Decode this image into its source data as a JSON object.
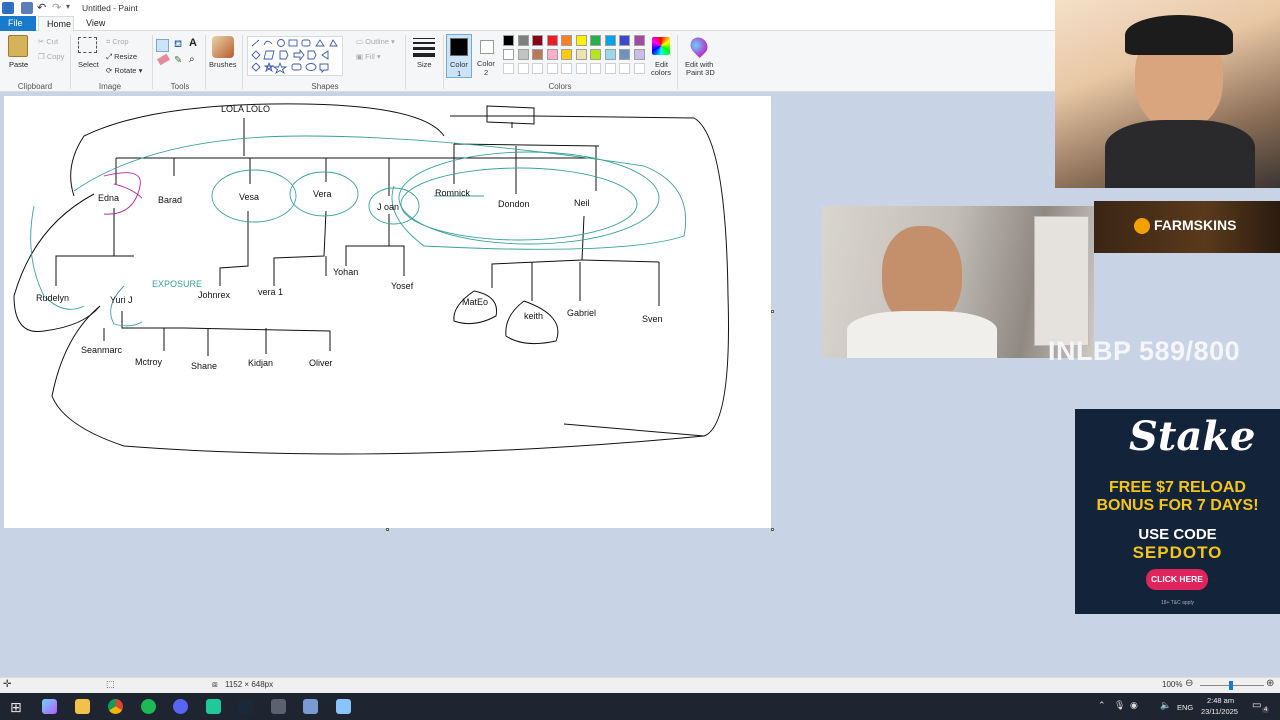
{
  "window": {
    "title": "Untitled - Paint"
  },
  "menu": {
    "file": "File",
    "home": "Home",
    "view": "View"
  },
  "ribbon": {
    "clipboard": {
      "paste": "Paste",
      "cut": "Cut",
      "copy": "Copy",
      "label": "Clipboard"
    },
    "image": {
      "select": "Select",
      "crop": "Crop",
      "resize": "Resize",
      "rotate": "Rotate",
      "label": "Image"
    },
    "tools": {
      "label": "Tools"
    },
    "brushes": {
      "label": "Brushes"
    },
    "shapes": {
      "outline": "Outline",
      "fill": "Fill",
      "label": "Shapes"
    },
    "size": {
      "label": "Size"
    },
    "color1": {
      "label": "Color",
      "num": "1"
    },
    "color2": {
      "label": "Color",
      "num": "2"
    },
    "colors": {
      "label": "Colors"
    },
    "edit_colors": {
      "line1": "Edit",
      "line2": "colors"
    },
    "edit_paint3d": {
      "line1": "Edit with",
      "line2": "Paint 3D"
    },
    "palette_row1": [
      "#000000",
      "#7f7f7f",
      "#880015",
      "#ed1c24",
      "#ff7f27",
      "#fff200",
      "#22b14c",
      "#00a2e8",
      "#3f48cc",
      "#a349a4"
    ],
    "palette_row2": [
      "#ffffff",
      "#c3c3c3",
      "#b97a57",
      "#ffaec9",
      "#ffc90e",
      "#efe4b0",
      "#b5e61d",
      "#99d9ea",
      "#7092be",
      "#c8bfe7"
    ]
  },
  "canvas": {
    "labels": {
      "root": "LOLA LOLO",
      "edna": "Edna",
      "barad": "Barad",
      "vesa": "Vesa",
      "vera": "Vera",
      "joan": "J oan",
      "romnick": "Romnick",
      "dondon": "Dondon",
      "neil": "Neil",
      "exposure": "EXPOSURE",
      "rudelyn": "Rudelyn",
      "yuri": "Yuri J",
      "johnrex": "Johnrex",
      "vera1": "vera 1",
      "yohan": "Yohan",
      "yosef": "Yosef",
      "mateo": "MatEo",
      "keith": "keith",
      "gabriel": "Gabriel",
      "sven": "Sven",
      "seanmarc": "Seanmarc",
      "mctroy": "Mctroy",
      "shane": "Shane",
      "kidjan": "Kidjan",
      "oliver": "Oliver"
    }
  },
  "status": {
    "dimensions": "1152 × 648px",
    "zoom": "100%"
  },
  "taskbar": {
    "lang": "ENG",
    "time": "2:48 am",
    "date": "23/11/2025",
    "notif": "4"
  },
  "overlay": {
    "counter": "INLBP 589/800",
    "farmskins": "FARMSKINS",
    "stake": {
      "logo": "Stake",
      "line1": "FREE $7 RELOAD",
      "line2": "BONUS FOR 7 DAYS!",
      "use_code": "USE CODE",
      "code": "SEPDOTO",
      "cta": "CLICK HERE",
      "fine": "18+ T&C apply"
    }
  }
}
